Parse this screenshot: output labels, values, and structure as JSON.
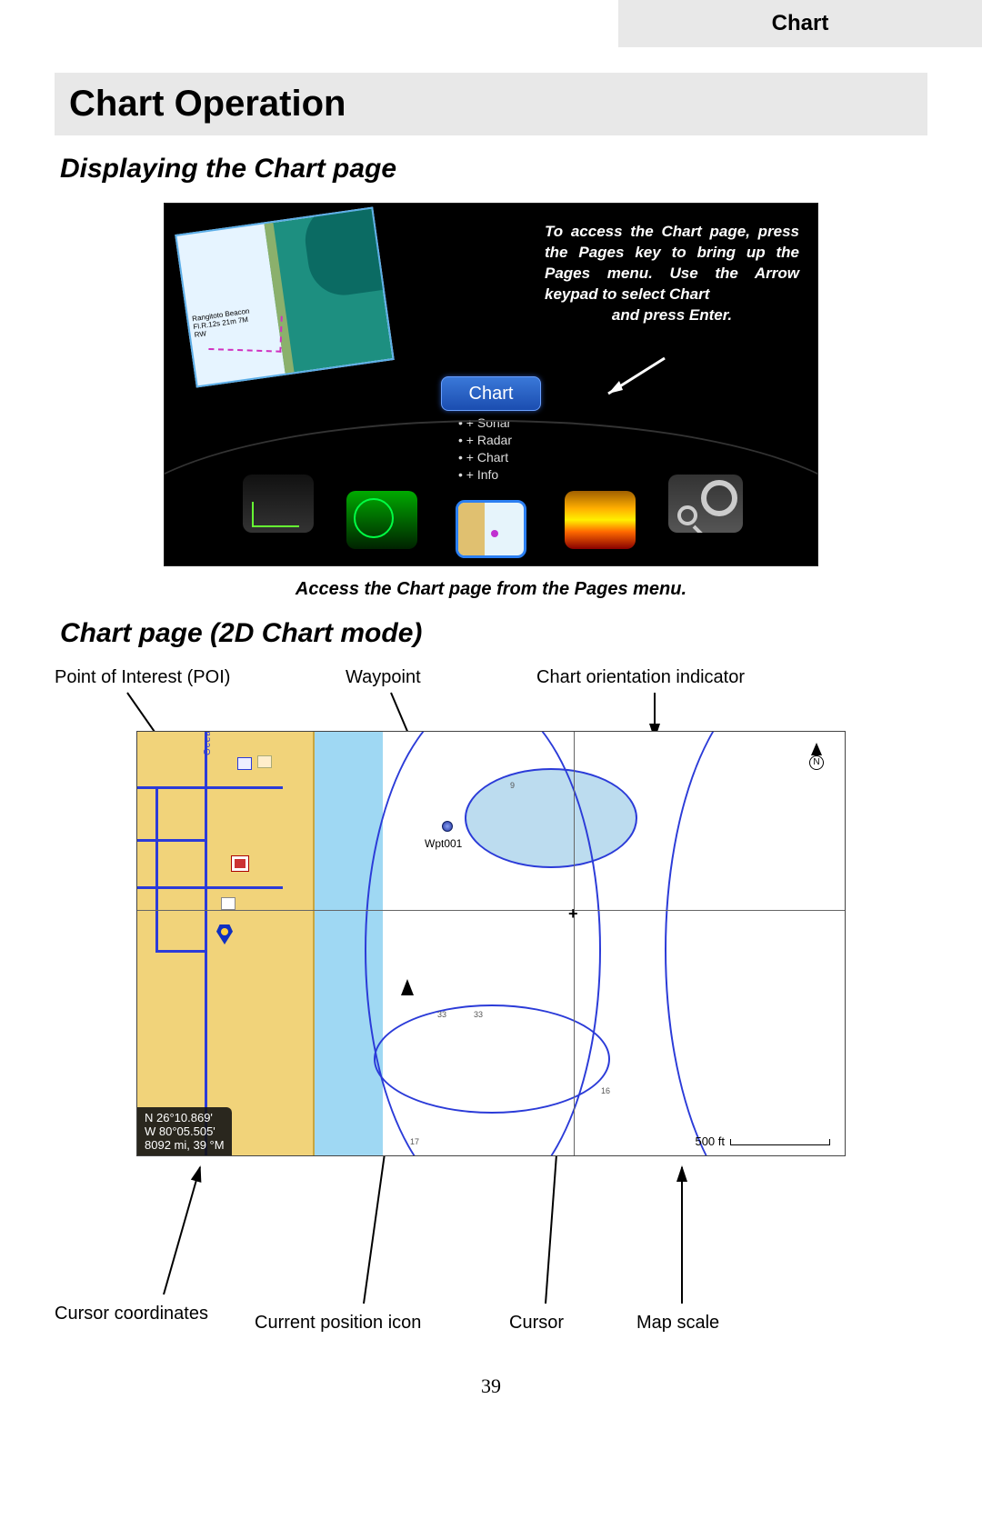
{
  "header": {
    "tab": "Chart"
  },
  "title": "Chart Operation",
  "sections": {
    "s1": "Displaying the Chart page",
    "s2": "Chart page (2D Chart mode)"
  },
  "figure1": {
    "instruction": "To access the Chart page, press the Pages key to bring up the Pages menu. Use the Arrow keypad to select Chart",
    "instruction_last": "and press Enter.",
    "button_label": "Chart",
    "options": [
      "+ Sonar",
      "+ Radar",
      "+ Chart",
      "+ Info"
    ],
    "map_beacon": "Rangitoto Beacon\nFl.R.12s 21m 7M\nRW",
    "tiles": [
      "steer-tile",
      "radar-tile",
      "chart-tile",
      "sonar-tile",
      "settings-tile"
    ],
    "caption": "Access the Chart page from the Pages menu."
  },
  "figure2": {
    "labels": {
      "poi": "Point of Interest (POI)",
      "wpt": "Waypoint",
      "orient": "Chart orientation indicator",
      "coords": "Cursor coordinates",
      "pos": "Current position icon",
      "cursor": "Cursor",
      "scale": "Map scale"
    },
    "waypoint_label": "Wpt001",
    "north_letter": "N",
    "street_label": "Ocean Dr",
    "depth_numbers": {
      "d9": "9",
      "d17": "17",
      "d16": "16",
      "d33a": "33",
      "d33b": "33"
    },
    "cursor_coords": {
      "lat": "N  26°10.869'",
      "lon": "W  80°05.505'",
      "dist": "8092 mi, 39 °M"
    },
    "scale_text": "500 ft"
  },
  "page_number": "39"
}
